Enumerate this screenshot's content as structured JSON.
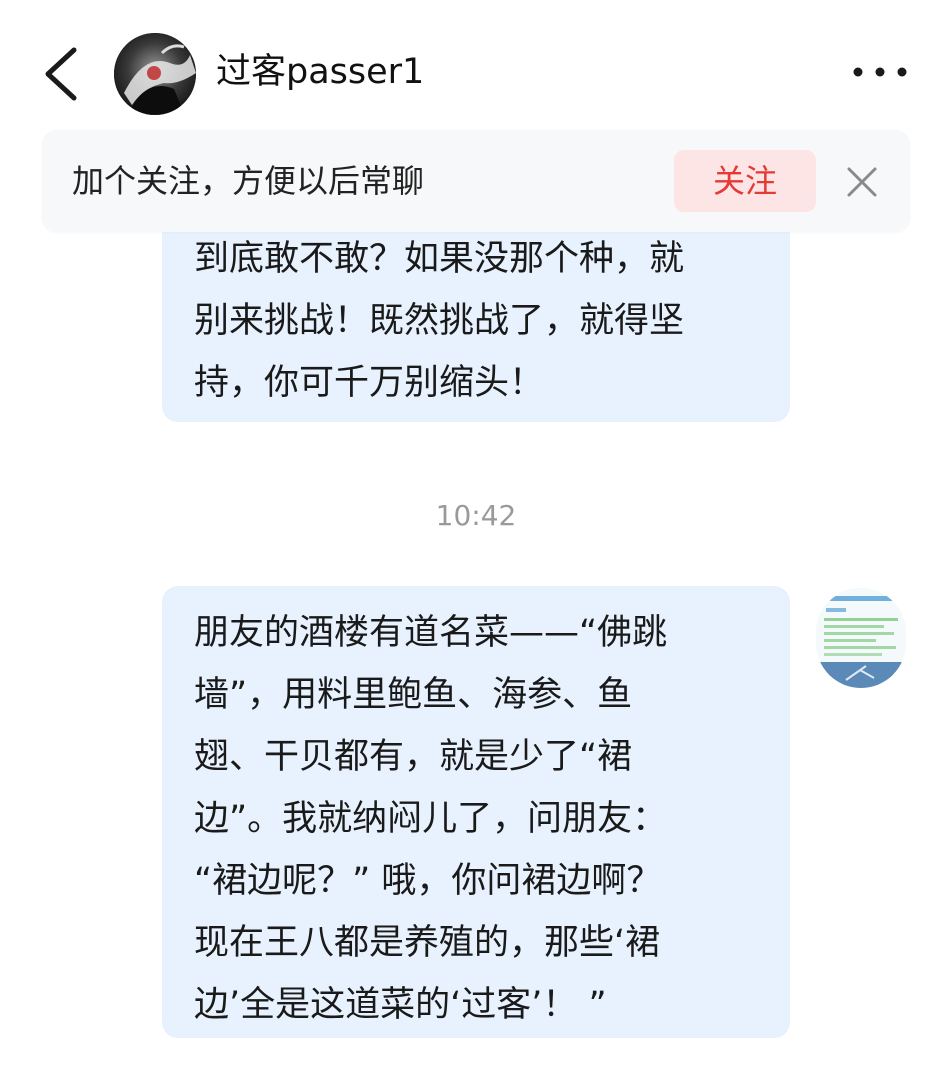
{
  "header": {
    "contact_name": "过客passer1",
    "back_icon": "chevron-left-icon",
    "more_icon": "more-horizontal-icon"
  },
  "banner": {
    "text": "加个关注，方便以后常聊",
    "follow_label": "关注",
    "close_icon": "close-icon"
  },
  "messages": [
    {
      "sender": "contact",
      "lines": [
        "到底敢不敢？如果没那个种，就",
        "别来挑战！既然挑战了，就得坚",
        "持，你可千万别缩头！"
      ]
    },
    {
      "sender": "contact",
      "lines": [
        "朋友的酒楼有道名菜——“佛跳",
        "墙”，用料里鲍鱼、海参、鱼",
        "翅、干贝都有，就是少了“裙",
        "边”。我就纳闷儿了，问朋友：",
        "“裙边呢？” 哦，你问裙边啊？",
        "现在王八都是养殖的，那些‘裙",
        "边’全是这道菜的‘过客’！ ”"
      ]
    }
  ],
  "timestamp": "10:42",
  "colors": {
    "bubble_bg": "#e7f2fe",
    "follow_text": "#e53935",
    "follow_bg": "#fde5e5",
    "banner_bg": "#f7f8fa",
    "timestamp": "#9a9a9a"
  }
}
